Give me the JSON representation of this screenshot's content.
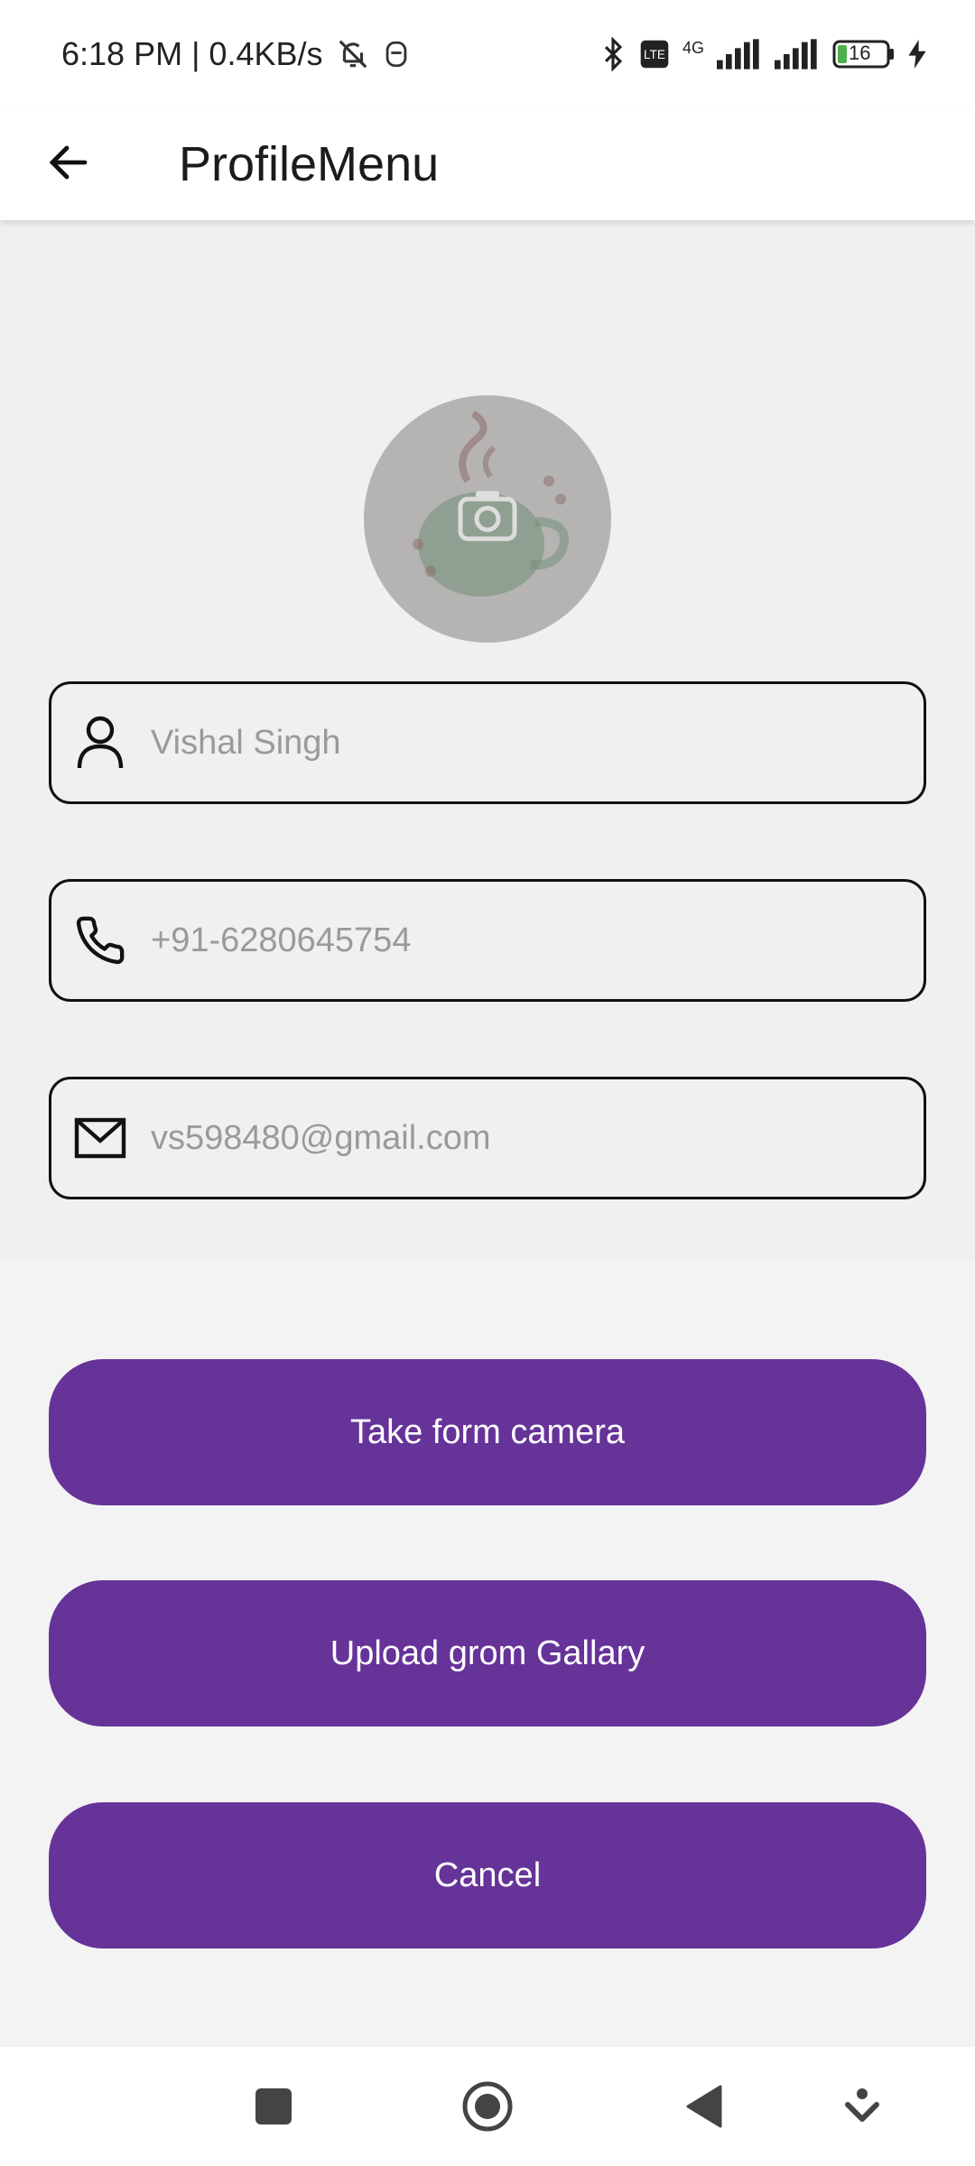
{
  "status_bar": {
    "time_and_speed": "6:18 PM | 0.4KB/s",
    "network": "4G",
    "battery": "16"
  },
  "app_bar": {
    "title": "ProfileMenu",
    "back_icon": "arrow-left-icon"
  },
  "profile": {
    "avatar_icon": "camera-icon",
    "fields": [
      {
        "icon": "person-icon",
        "value": "Vishal Singh"
      },
      {
        "icon": "phone-icon",
        "value": "+91-6280645754"
      },
      {
        "icon": "mail-icon",
        "value": "vs598480@gmail.com"
      }
    ]
  },
  "sheet": {
    "buttons": [
      {
        "label": "Take form camera"
      },
      {
        "label": "Upload grom Gallary"
      },
      {
        "label": "Cancel"
      }
    ]
  },
  "colors": {
    "accent": "#663399",
    "field_border": "#111111",
    "avatar_bg": "#b5b4b2"
  }
}
